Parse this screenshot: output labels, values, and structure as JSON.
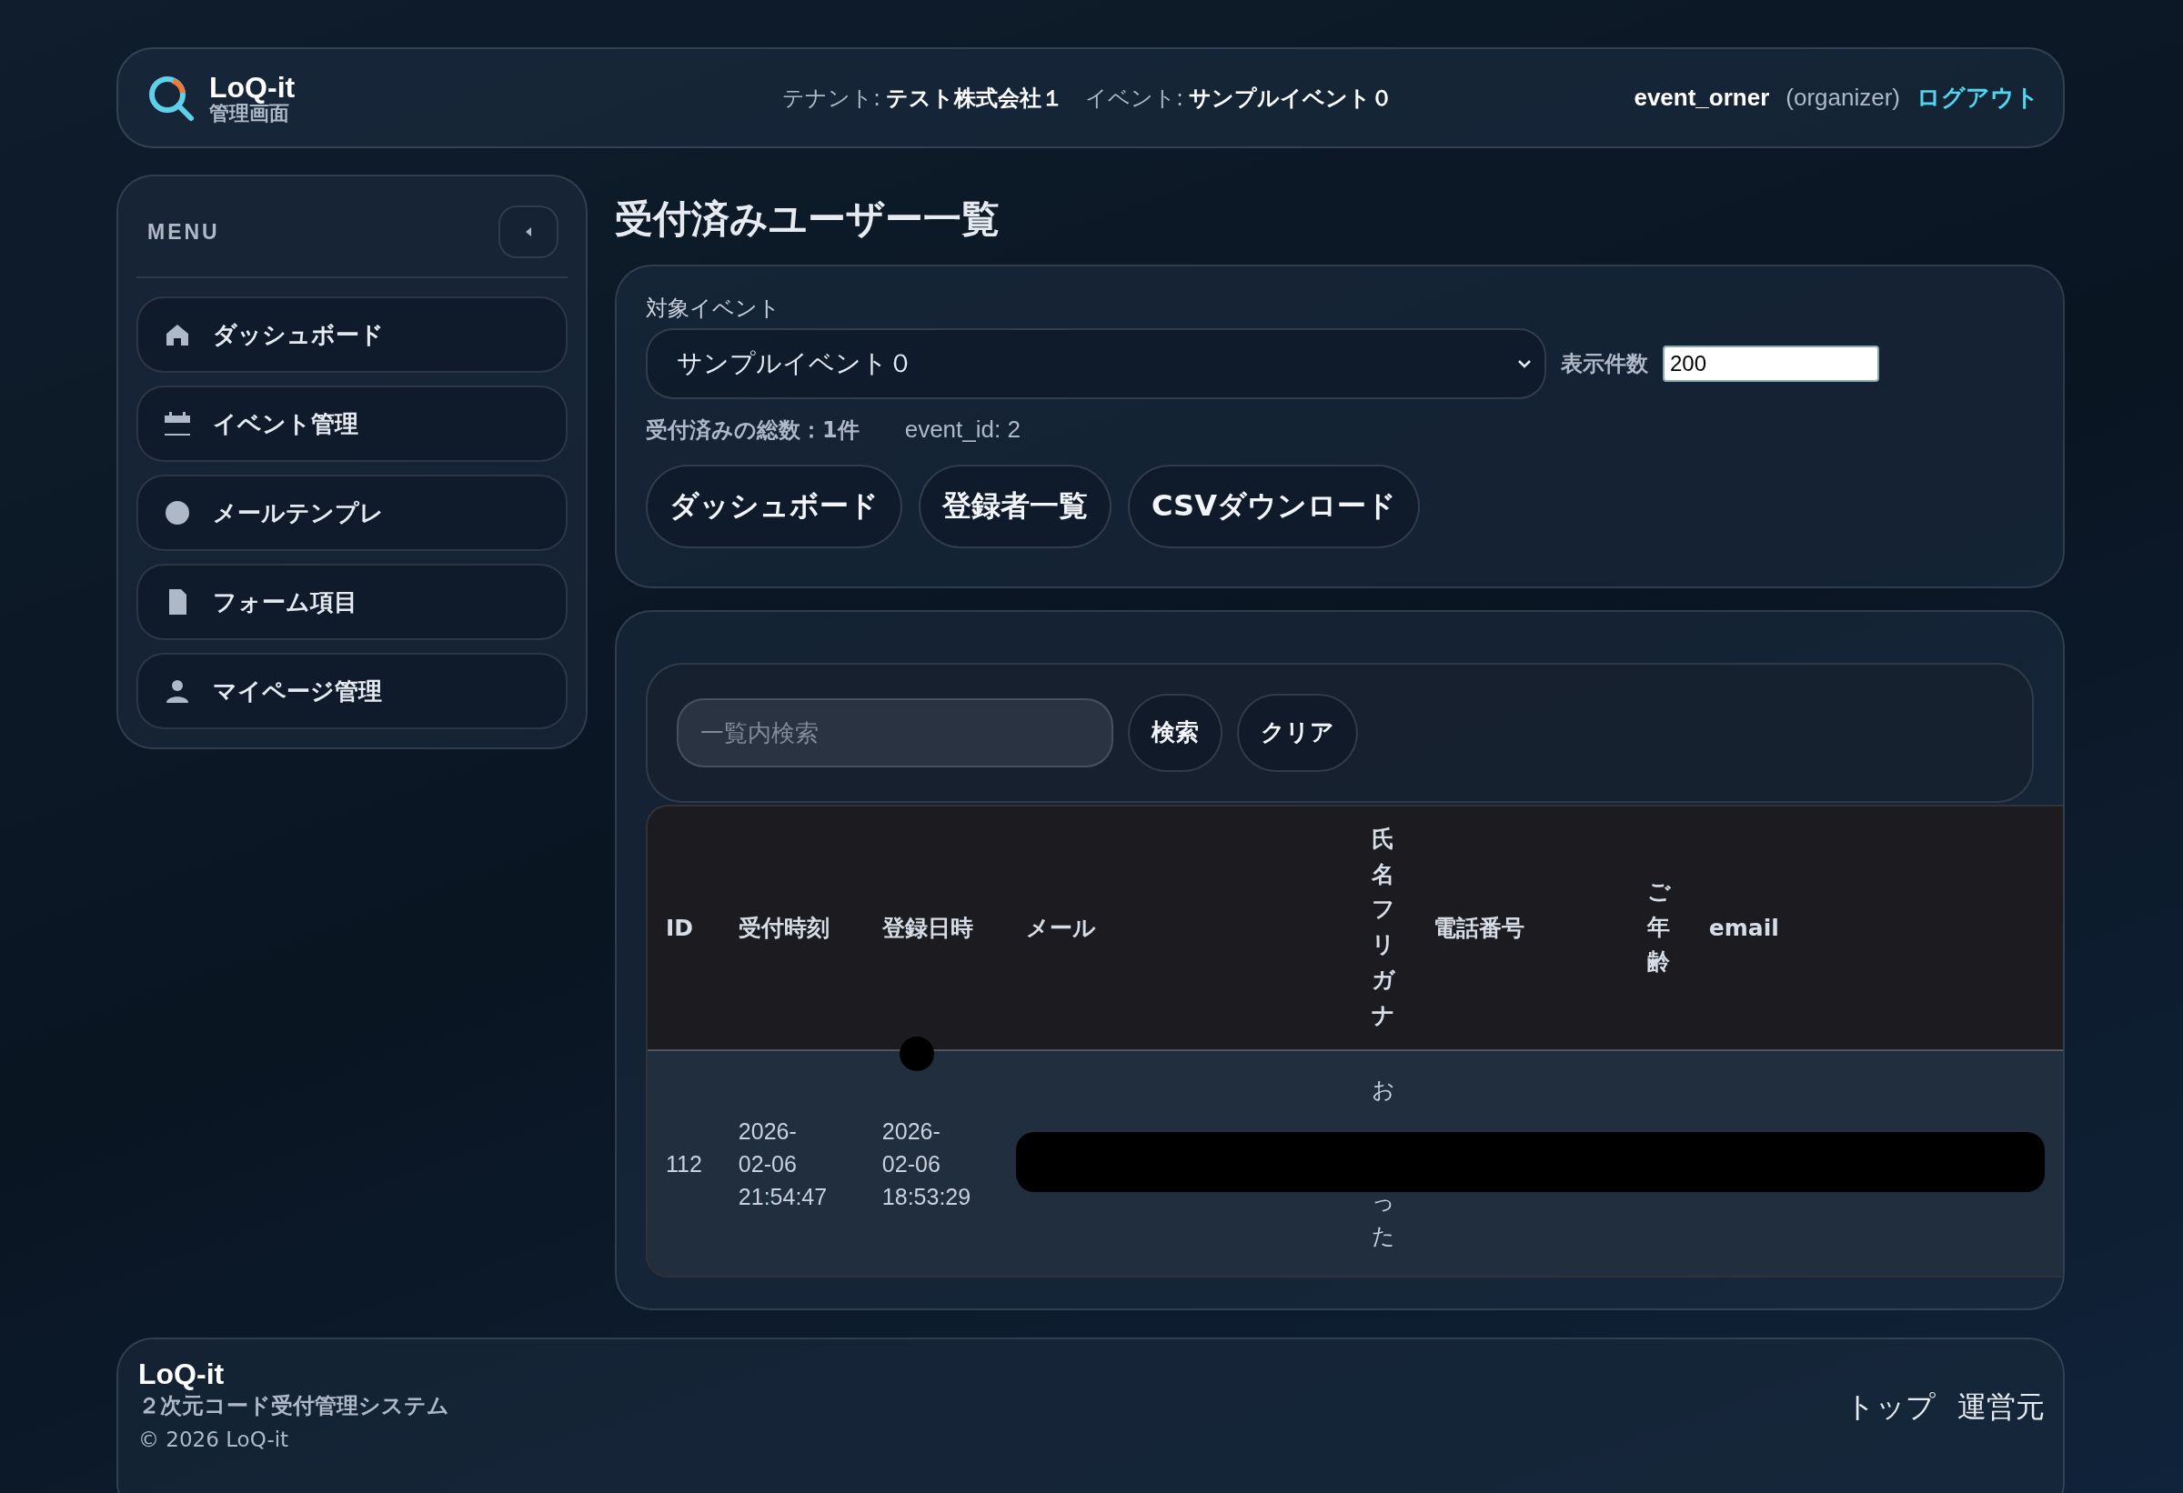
{
  "header": {
    "logo_title": "LoQ-it",
    "logo_subtitle": "管理画面",
    "tenant_label": "テナント:",
    "tenant": "テスト株式会社１",
    "event_label": "イベント:",
    "event": "サンプルイベント０",
    "user": "event_orner",
    "role": "(organizer)",
    "logout": "ログアウト"
  },
  "sidebar": {
    "title": "MENU",
    "items": [
      {
        "label": "ダッシュボード"
      },
      {
        "label": "イベント管理"
      },
      {
        "label": "メールテンプレ"
      },
      {
        "label": "フォーム項目"
      },
      {
        "label": "マイページ管理"
      }
    ]
  },
  "page_title": "受付済みユーザー一覧",
  "filter": {
    "event_label": "対象イベント",
    "event_value": "サンプルイベント０",
    "count_label": "表示件数",
    "count_value": "200",
    "total": "受付済みの総数：1件",
    "event_id": "event_id: 2",
    "buttons": [
      "ダッシュボード",
      "登録者一覧",
      "CSVダウンロード"
    ]
  },
  "search": {
    "placeholder": "一覧内検索",
    "buttons": [
      "検索",
      "クリア"
    ]
  },
  "table": {
    "columns": [
      {
        "label": "ID",
        "vertical": false
      },
      {
        "label": "受付時刻",
        "vertical": false
      },
      {
        "label": "登録日時",
        "vertical": false
      },
      {
        "label": "メール",
        "vertical": false
      },
      {
        "label": "氏名フリガナ",
        "vertical": true
      },
      {
        "label": "電話番号",
        "vertical": false
      },
      {
        "label": "ご年齢",
        "vertical": true
      },
      {
        "label": "email",
        "vertical": false
      }
    ],
    "rows": [
      {
        "id": "112",
        "received": "2026-02-06 21:54:47",
        "registered": "2026-02-06 18:53:29",
        "furigana_top": "お",
        "furigana_bottom": "った",
        "redacted": true
      }
    ]
  },
  "footer": {
    "title": "LoQ-it",
    "subtitle": "２次元コード受付管理システム",
    "copyright": "© 2026 LoQ-it",
    "links": [
      "トップ",
      "運営元"
    ]
  }
}
